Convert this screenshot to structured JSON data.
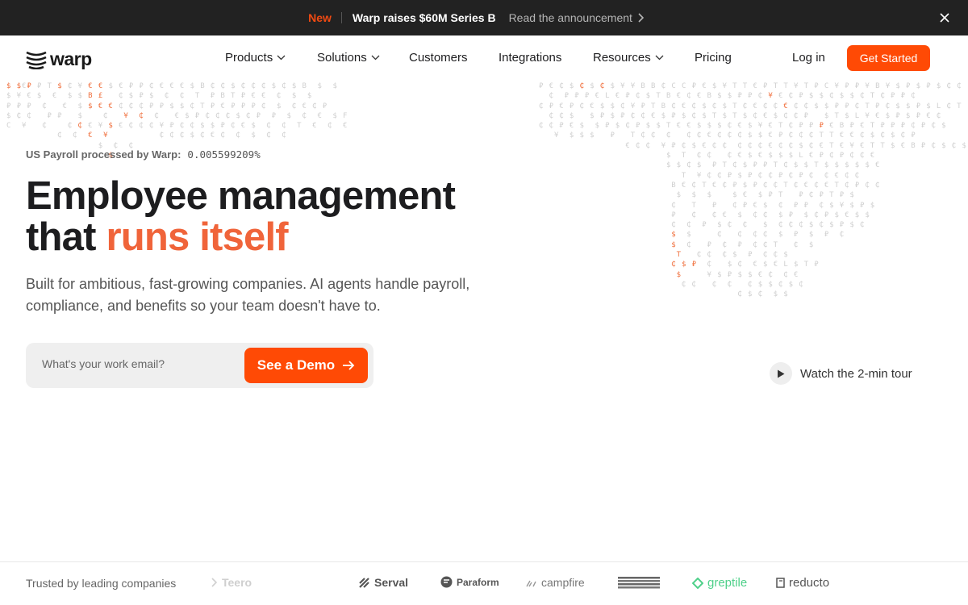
{
  "announcement": {
    "tag": "New",
    "headline": "Warp raises $60M Series B",
    "link": "Read the announcement"
  },
  "nav": {
    "logo": "warp",
    "items": [
      {
        "label": "Products",
        "dropdown": true
      },
      {
        "label": "Solutions",
        "dropdown": true
      },
      {
        "label": "Customers",
        "dropdown": false
      },
      {
        "label": "Integrations",
        "dropdown": false
      },
      {
        "label": "Resources",
        "dropdown": true
      },
      {
        "label": "Pricing",
        "dropdown": false
      }
    ],
    "login": "Log in",
    "cta": "Get Started"
  },
  "hero": {
    "ticker_label": "US Payroll processed by Warp:",
    "ticker_value": "0.005599209%",
    "title_line1": "Employee management",
    "title_line2_prefix": "that ",
    "title_accent": "runs itself",
    "subtitle": "Built for ambitious, fast-growing companies. AI agents handle payroll, compliance, and benefits so your team doesn't have to.",
    "email_placeholder": "What's your work email?",
    "demo_button": "See a Demo",
    "tour_label": "Watch the 2-min tour"
  },
  "trusted": {
    "label": "Trusted by leading companies",
    "brands": [
      "Teero",
      "Serval",
      "Paraform",
      "campfire",
      "bluesmart",
      "greptile",
      "reducto"
    ]
  },
  "colors": {
    "accent": "#ff4a05",
    "announcement_bg": "#222222",
    "greptile": "#4fd08a"
  }
}
